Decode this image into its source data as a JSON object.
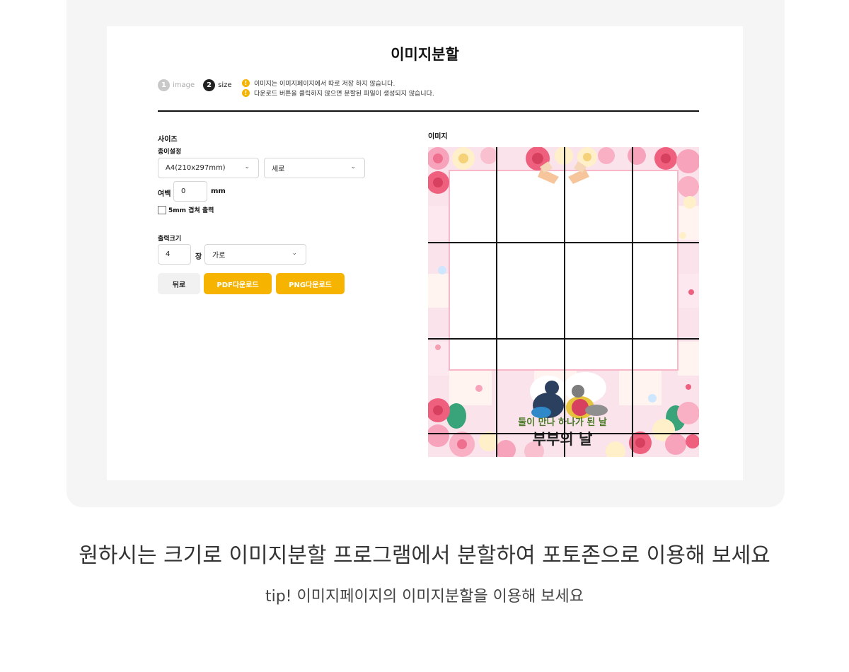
{
  "page": {
    "title": "이미지분할",
    "steps": [
      {
        "num": "1",
        "label": "image"
      },
      {
        "num": "2",
        "label": "size"
      }
    ],
    "notices": [
      "이미지는 이미지페이지에서 따로 저장 하지 않습니다.",
      "다운로드 버튼을 클릭하지 않으면 분할된 파일이 생성되지 않습니다."
    ],
    "warn_glyph": "!"
  },
  "form": {
    "size_label": "사이즈",
    "paper_label": "종이설정",
    "paper_size": "A4(210x297mm)",
    "orientation": "세로",
    "margin_label": "여백",
    "margin_value": "0",
    "margin_unit": "mm",
    "overlap_label": "5mm 겹쳐 출력",
    "overlap_checked": false,
    "output_label": "출력크기",
    "output_count": "4",
    "output_unit": "장",
    "output_orientation": "가로",
    "chevron": "⌄"
  },
  "buttons": {
    "back": "뒤로",
    "pdf": "PDF다운로드",
    "png": "PNG다운로드"
  },
  "preview": {
    "label": "이미지",
    "caption_small": "둘이 만나 하나가 된 날",
    "caption_big": "부부의 날",
    "grid_cols": 4,
    "grid_rows": 4
  },
  "footer": {
    "main": "원하시는 크기로 이미지분할 프로그램에서 분할하여 포토존으로 이용해 보세요",
    "tip": "tip! 이미지페이지의 이미지분할을 이용해 보세요"
  },
  "colors": {
    "accent": "#f6b400",
    "warn": "#f5b400",
    "frame_bg": "#f5f5f5",
    "pink": "#f8c6d6",
    "rose": "#ef5f7e"
  }
}
